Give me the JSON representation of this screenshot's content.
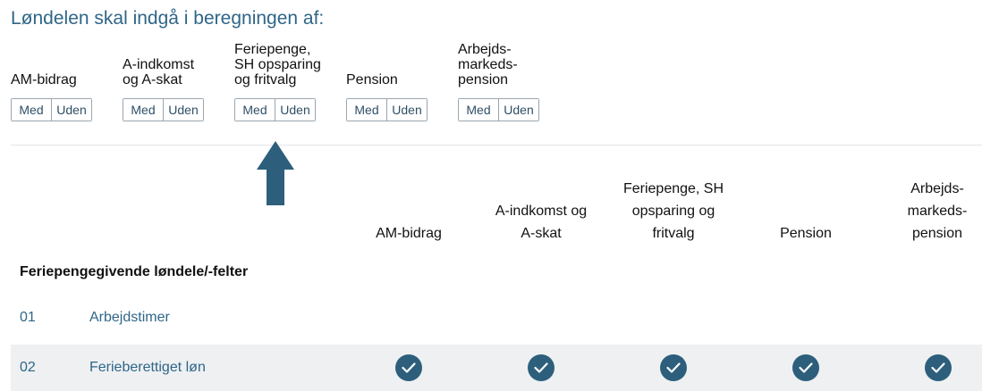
{
  "heading": "Løndelen skal indgå i beregningen af:",
  "toggle_groups": [
    {
      "label": "AM-bidrag",
      "on_label": "Med",
      "off_label": "Uden"
    },
    {
      "label": "A-indkomst\nog A-skat",
      "on_label": "Med",
      "off_label": "Uden"
    },
    {
      "label": "Feriepenge,\nSH opsparing\nog fritvalg",
      "on_label": "Med",
      "off_label": "Uden"
    },
    {
      "label": "Pension",
      "on_label": "Med",
      "off_label": "Uden"
    },
    {
      "label": "Arbejds-\nmarkeds-\npension",
      "on_label": "Med",
      "off_label": "Uden"
    }
  ],
  "arrow_color": "#2d5f7c",
  "columns": [
    "AM-bidrag",
    "A-indkomst og\nA-skat",
    "Feriepenge, SH\nopsparing og\nfritvalg",
    "Pension",
    "Arbejds-\nmarkeds-\npension"
  ],
  "section_title": "Feriepengegivende løndele/-felter",
  "rows": [
    {
      "number": "01",
      "name": "Arbejdstimer",
      "checks": [
        false,
        false,
        false,
        false,
        false
      ]
    },
    {
      "number": "02",
      "name": "Ferieberettiget løn",
      "checks": [
        true,
        true,
        true,
        true,
        true
      ]
    }
  ],
  "accent_color": "#2d5f7c"
}
